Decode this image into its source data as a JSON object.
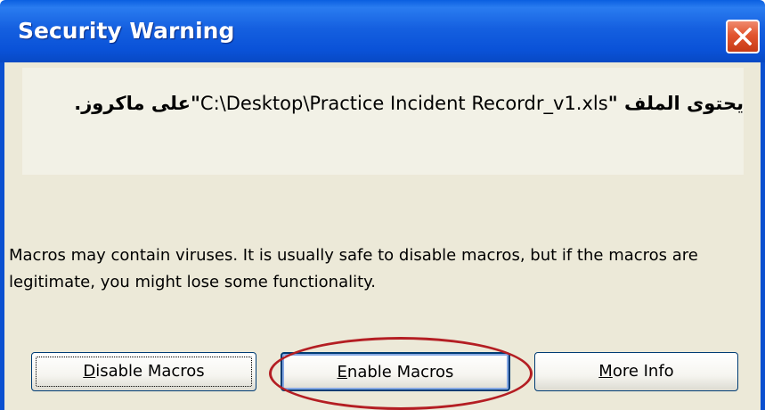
{
  "window": {
    "title": "Security Warning",
    "close_icon": "close-x"
  },
  "message": {
    "prefix_ar": "يحتوى الملف \"",
    "file_path": "C:\\Desktop\\Practice Incident Recordr_v1.xls",
    "suffix_ar": "\"على ماكروز."
  },
  "warning": {
    "text": "Macros may contain viruses. It is usually safe to disable macros, but if the macros are legitimate, you might lose some functionality."
  },
  "buttons": {
    "disable": {
      "mnemonic": "D",
      "rest": "isable Macros"
    },
    "enable": {
      "mnemonic": "E",
      "rest": "nable Macros"
    },
    "more_info": {
      "mnemonic": "M",
      "rest": "ore Info"
    }
  },
  "colors": {
    "titlebar": "#0a52d8",
    "body": "#ece9d8",
    "close": "#e2552f",
    "annotation": "#b41e23"
  }
}
